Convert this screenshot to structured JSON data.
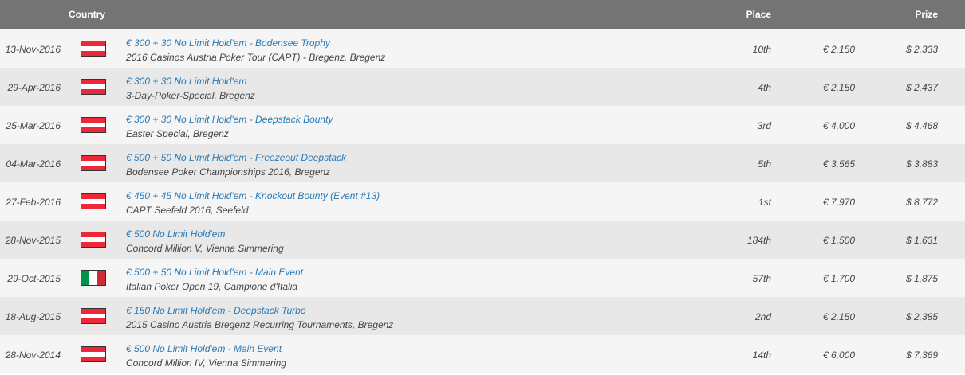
{
  "header": {
    "country": "Country",
    "place": "Place",
    "prize": "Prize"
  },
  "colors": {
    "header_bg": "#747474",
    "link": "#2a7ab5",
    "row_odd": "#f5f5f5",
    "row_even": "#e8e8e8"
  },
  "rows": [
    {
      "date": "13-Nov-2016",
      "flag": "austria",
      "flag_icon": "austria-flag-icon",
      "event": "€ 300 + 30 No Limit Hold'em - Bodensee Trophy",
      "venue": "2016 Casinos Austria Poker Tour (CAPT) - Bregenz, Bregenz",
      "place": "10th",
      "buyin": "€ 2,150",
      "prize": "$ 2,333"
    },
    {
      "date": "29-Apr-2016",
      "flag": "austria",
      "flag_icon": "austria-flag-icon",
      "event": "€ 300 + 30 No Limit Hold'em",
      "venue": "3-Day-Poker-Special, Bregenz",
      "place": "4th",
      "buyin": "€ 2,150",
      "prize": "$ 2,437"
    },
    {
      "date": "25-Mar-2016",
      "flag": "austria",
      "flag_icon": "austria-flag-icon",
      "event": "€ 300 + 30 No Limit Hold'em - Deepstack Bounty",
      "venue": "Easter Special, Bregenz",
      "place": "3rd",
      "buyin": "€ 4,000",
      "prize": "$ 4,468"
    },
    {
      "date": "04-Mar-2016",
      "flag": "austria",
      "flag_icon": "austria-flag-icon",
      "event": "€ 500 + 50 No Limit Hold'em - Freezeout Deepstack",
      "venue": "Bodensee Poker Championships 2016, Bregenz",
      "place": "5th",
      "buyin": "€ 3,565",
      "prize": "$ 3,883"
    },
    {
      "date": "27-Feb-2016",
      "flag": "austria",
      "flag_icon": "austria-flag-icon",
      "event": "€ 450 + 45 No Limit Hold'em - Knockout Bounty (Event #13)",
      "venue": "CAPT Seefeld 2016, Seefeld",
      "place": "1st",
      "buyin": "€ 7,970",
      "prize": "$ 8,772"
    },
    {
      "date": "28-Nov-2015",
      "flag": "austria",
      "flag_icon": "austria-flag-icon",
      "event": "€ 500 No Limit Hold'em",
      "venue": "Concord Million V, Vienna Simmering",
      "place": "184th",
      "buyin": "€ 1,500",
      "prize": "$ 1,631"
    },
    {
      "date": "29-Oct-2015",
      "flag": "italy",
      "flag_icon": "italy-flag-icon",
      "event": "€ 500 + 50 No Limit Hold'em - Main Event",
      "venue": "Italian Poker Open 19, Campione d'Italia",
      "place": "57th",
      "buyin": "€ 1,700",
      "prize": "$ 1,875"
    },
    {
      "date": "18-Aug-2015",
      "flag": "austria",
      "flag_icon": "austria-flag-icon",
      "event": "€ 150 No Limit Hold'em - Deepstack Turbo",
      "venue": "2015 Casino Austria Bregenz Recurring Tournaments, Bregenz",
      "place": "2nd",
      "buyin": "€ 2,150",
      "prize": "$ 2,385"
    },
    {
      "date": "28-Nov-2014",
      "flag": "austria",
      "flag_icon": "austria-flag-icon",
      "event": "€ 500 No Limit Hold'em - Main Event",
      "venue": "Concord Million IV, Vienna Simmering",
      "place": "14th",
      "buyin": "€ 6,000",
      "prize": "$ 7,369"
    }
  ]
}
